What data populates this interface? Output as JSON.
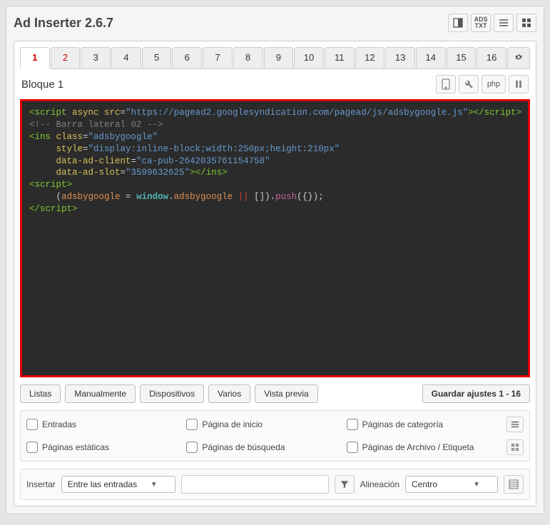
{
  "header": {
    "title": "Ad Inserter 2.6.7"
  },
  "tabs": [
    "1",
    "2",
    "3",
    "4",
    "5",
    "6",
    "7",
    "8",
    "9",
    "10",
    "11",
    "12",
    "13",
    "14",
    "15",
    "16"
  ],
  "active_tab": 0,
  "block": {
    "title": "Bloque 1",
    "toolbar_php": "php"
  },
  "code": {
    "line1_open": "<script",
    "line1_async": " async",
    "line1_src_attr": " src",
    "line1_eq": "=",
    "line1_url": "\"https://pagead2.googlesyndication.com/pagead/js/adsbygoogle.js\"",
    "line1_close": "></",
    "line1_tag_close": "script",
    "line1_end": ">",
    "line2": "<!-- Barra lateral 02 -->",
    "line3_open": "<ins",
    "line3_class_attr": " class",
    "line3_class_val": "\"adsbygoogle\"",
    "line4_style_attr": "     style",
    "line4_style_val": "\"display:inline-block;width:250px;height:210px\"",
    "line5_attr": "     data-ad-client",
    "line5_val": "\"ca-pub-2642035761154758\"",
    "line6_attr": "     data-ad-slot",
    "line6_val": "\"3599632625\"",
    "line6_close": "></ins>",
    "line7": "<script>",
    "line8_indent": "     ",
    "line8_open": "(",
    "line8_var": "adsbygoogle",
    "line8_eq": " = ",
    "line8_window": "window",
    "line8_dot": ".",
    "line8_prop": "adsbygoogle",
    "line8_or": " || ",
    "line8_arr": "[]",
    "line8_paren": ").",
    "line8_push": "push",
    "line8_args": "(",
    "line8_obj": "{}",
    "line8_end": ");",
    "line9_open": "</",
    "line9_tag": "script",
    "line9_close": ">"
  },
  "buttons": {
    "listas": "Listas",
    "manualmente": "Manualmente",
    "dispositivos": "Dispositivos",
    "varios": "Varios",
    "vista_previa": "Vista previa",
    "guardar": "Guardar ajustes 1 - 16"
  },
  "checkboxes": {
    "entradas": "Entradas",
    "pagina_inicio": "Página de inicio",
    "paginas_categoria": "Páginas de categoría",
    "paginas_estaticas": "Páginas estáticas",
    "paginas_busqueda": "Páginas de búsqueda",
    "paginas_archivo": "Páginas de Archivo / Etiqueta"
  },
  "insert": {
    "label": "Insertar",
    "value": "Entre las entradas",
    "align_label": "Alineación",
    "align_value": "Centro"
  }
}
